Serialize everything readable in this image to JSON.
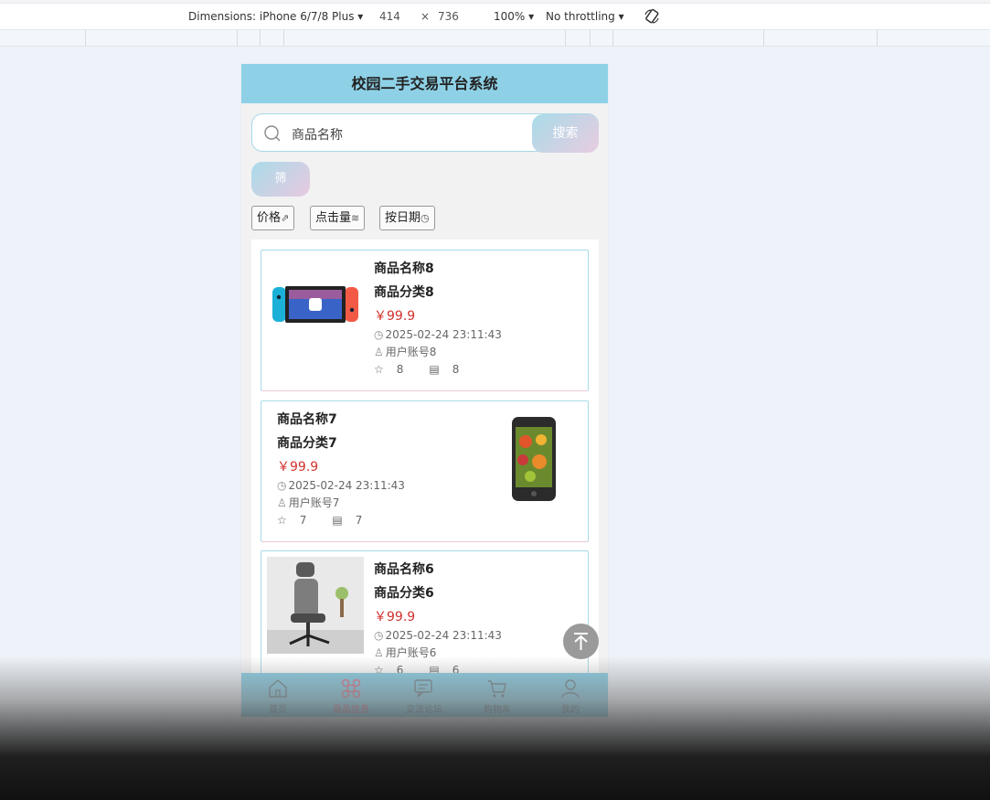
{
  "devtools": {
    "dimensions_label": "Dimensions: iPhone 6/7/8 Plus ▾",
    "width": "414",
    "times": "×",
    "height": "736",
    "zoom": "100% ▾",
    "throttling": "No throttling ▾",
    "rotate_icon": "rotate-icon"
  },
  "app": {
    "title": "校园二手交易平台系统",
    "search": {
      "placeholder": "商品名称",
      "button": "搜索"
    },
    "filter_button": "筛",
    "sort": [
      {
        "label": "价格",
        "icon": "trend-icon",
        "glyph": "⇗"
      },
      {
        "label": "点击量",
        "icon": "bar-chart-icon",
        "glyph": "≋"
      },
      {
        "label": "按日期",
        "icon": "clock-icon",
        "glyph": "◷"
      }
    ],
    "products": [
      {
        "name": "商品名称8",
        "category": "商品分类8",
        "price": "￥99.9",
        "time": "2025-02-24 23:11:43",
        "user": "用户账号8",
        "favorites": "8",
        "comments": "8",
        "image": "game-console"
      },
      {
        "name": "商品名称7",
        "category": "商品分类7",
        "price": "￥99.9",
        "time": "2025-02-24 23:11:43",
        "user": "用户账号7",
        "favorites": "7",
        "comments": "7",
        "image": "smartphone"
      },
      {
        "name": "商品名称6",
        "category": "商品分类6",
        "price": "￥99.9",
        "time": "2025-02-24 23:11:43",
        "user": "用户账号6",
        "favorites": "6",
        "comments": "6",
        "image": "office-chair"
      }
    ],
    "back_to_top_icon": "arrow-up-icon",
    "tabs": [
      {
        "label": "首页",
        "icon": "home-icon",
        "active": false
      },
      {
        "label": "商品信息",
        "icon": "command-icon",
        "active": true
      },
      {
        "label": "交流论坛",
        "icon": "chat-icon",
        "active": false
      },
      {
        "label": "购物车",
        "icon": "cart-icon",
        "active": false
      },
      {
        "label": "我的",
        "icon": "user-icon",
        "active": false
      }
    ],
    "colors": {
      "header": "#8ed1e6",
      "price": "#d2322d",
      "active_tab": "#e07b93"
    }
  }
}
